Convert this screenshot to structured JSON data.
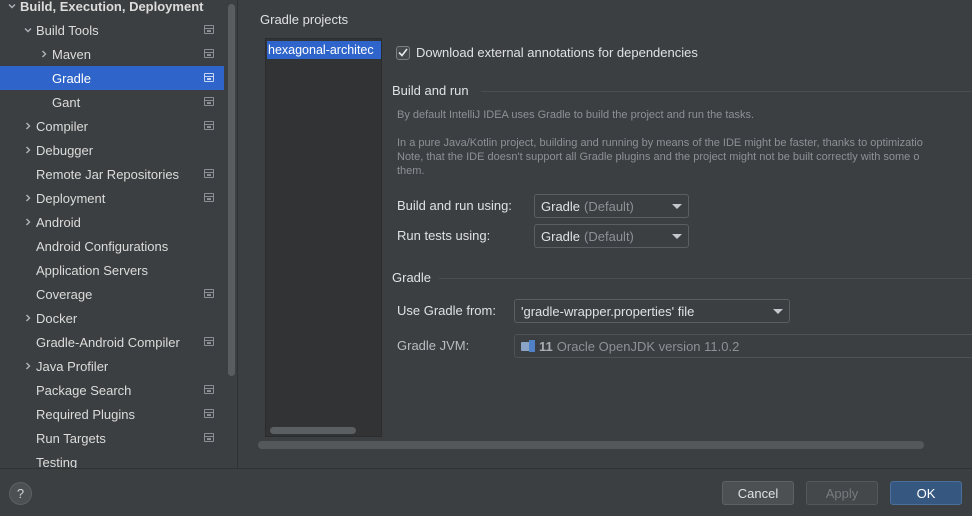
{
  "sidebar": {
    "items": [
      {
        "label": "Build, Execution, Deployment",
        "indent": 0,
        "chevron": "down",
        "bold": true,
        "selected": false,
        "project_icon": false
      },
      {
        "label": "Build Tools",
        "indent": 1,
        "chevron": "down",
        "bold": false,
        "selected": false,
        "project_icon": true
      },
      {
        "label": "Maven",
        "indent": 2,
        "chevron": "right",
        "bold": false,
        "selected": false,
        "project_icon": true
      },
      {
        "label": "Gradle",
        "indent": 2,
        "chevron": "none",
        "bold": false,
        "selected": true,
        "project_icon": true
      },
      {
        "label": "Gant",
        "indent": 2,
        "chevron": "none",
        "bold": false,
        "selected": false,
        "project_icon": true
      },
      {
        "label": "Compiler",
        "indent": 1,
        "chevron": "right",
        "bold": false,
        "selected": false,
        "project_icon": true
      },
      {
        "label": "Debugger",
        "indent": 1,
        "chevron": "right",
        "bold": false,
        "selected": false,
        "project_icon": false
      },
      {
        "label": "Remote Jar Repositories",
        "indent": 1,
        "chevron": "none",
        "bold": false,
        "selected": false,
        "project_icon": true
      },
      {
        "label": "Deployment",
        "indent": 1,
        "chevron": "right",
        "bold": false,
        "selected": false,
        "project_icon": true
      },
      {
        "label": "Android",
        "indent": 1,
        "chevron": "right",
        "bold": false,
        "selected": false,
        "project_icon": false
      },
      {
        "label": "Android Configurations",
        "indent": 1,
        "chevron": "none",
        "bold": false,
        "selected": false,
        "project_icon": false
      },
      {
        "label": "Application Servers",
        "indent": 1,
        "chevron": "none",
        "bold": false,
        "selected": false,
        "project_icon": false
      },
      {
        "label": "Coverage",
        "indent": 1,
        "chevron": "none",
        "bold": false,
        "selected": false,
        "project_icon": true
      },
      {
        "label": "Docker",
        "indent": 1,
        "chevron": "right",
        "bold": false,
        "selected": false,
        "project_icon": false
      },
      {
        "label": "Gradle-Android Compiler",
        "indent": 1,
        "chevron": "none",
        "bold": false,
        "selected": false,
        "project_icon": true
      },
      {
        "label": "Java Profiler",
        "indent": 1,
        "chevron": "right",
        "bold": false,
        "selected": false,
        "project_icon": false
      },
      {
        "label": "Package Search",
        "indent": 1,
        "chevron": "none",
        "bold": false,
        "selected": false,
        "project_icon": true
      },
      {
        "label": "Required Plugins",
        "indent": 1,
        "chevron": "none",
        "bold": false,
        "selected": false,
        "project_icon": true
      },
      {
        "label": "Run Targets",
        "indent": 1,
        "chevron": "none",
        "bold": false,
        "selected": false,
        "project_icon": true
      },
      {
        "label": "Testing",
        "indent": 1,
        "chevron": "none",
        "bold": false,
        "selected": false,
        "project_icon": false
      }
    ]
  },
  "content": {
    "section_title": "Gradle projects",
    "project_item": "hexagonal-architec",
    "download_annotations": {
      "label": "Download external annotations for dependencies",
      "checked": true
    },
    "build_and_run": {
      "title": "Build and run",
      "desc_line1": "By default IntelliJ IDEA uses Gradle to build the project and run the tasks.",
      "desc_line2": "In a pure Java/Kotlin project, building and running by means of the IDE might be faster, thanks to optimizatio",
      "desc_line3": "Note, that the IDE doesn't support all Gradle plugins and the project might not be built correctly with some o",
      "desc_line4": "them.",
      "build_run_label": "Build and run using:",
      "build_run_value": "Gradle",
      "build_run_suffix": "(Default)",
      "run_tests_label": "Run tests using:",
      "run_tests_value": "Gradle",
      "run_tests_suffix": "(Default)"
    },
    "gradle": {
      "title": "Gradle",
      "use_from_label": "Use Gradle from:",
      "use_from_value": "'gradle-wrapper.properties' file",
      "jvm_label": "Gradle JVM:",
      "jvm_version_num": "11",
      "jvm_value": "Oracle OpenJDK version 11.0.2"
    }
  },
  "footer": {
    "help": "?",
    "cancel": "Cancel",
    "apply": "Apply",
    "ok": "OK"
  },
  "colors": {
    "selection": "#2f65ca",
    "background": "#3c3f41",
    "primary_button": "#365880"
  }
}
